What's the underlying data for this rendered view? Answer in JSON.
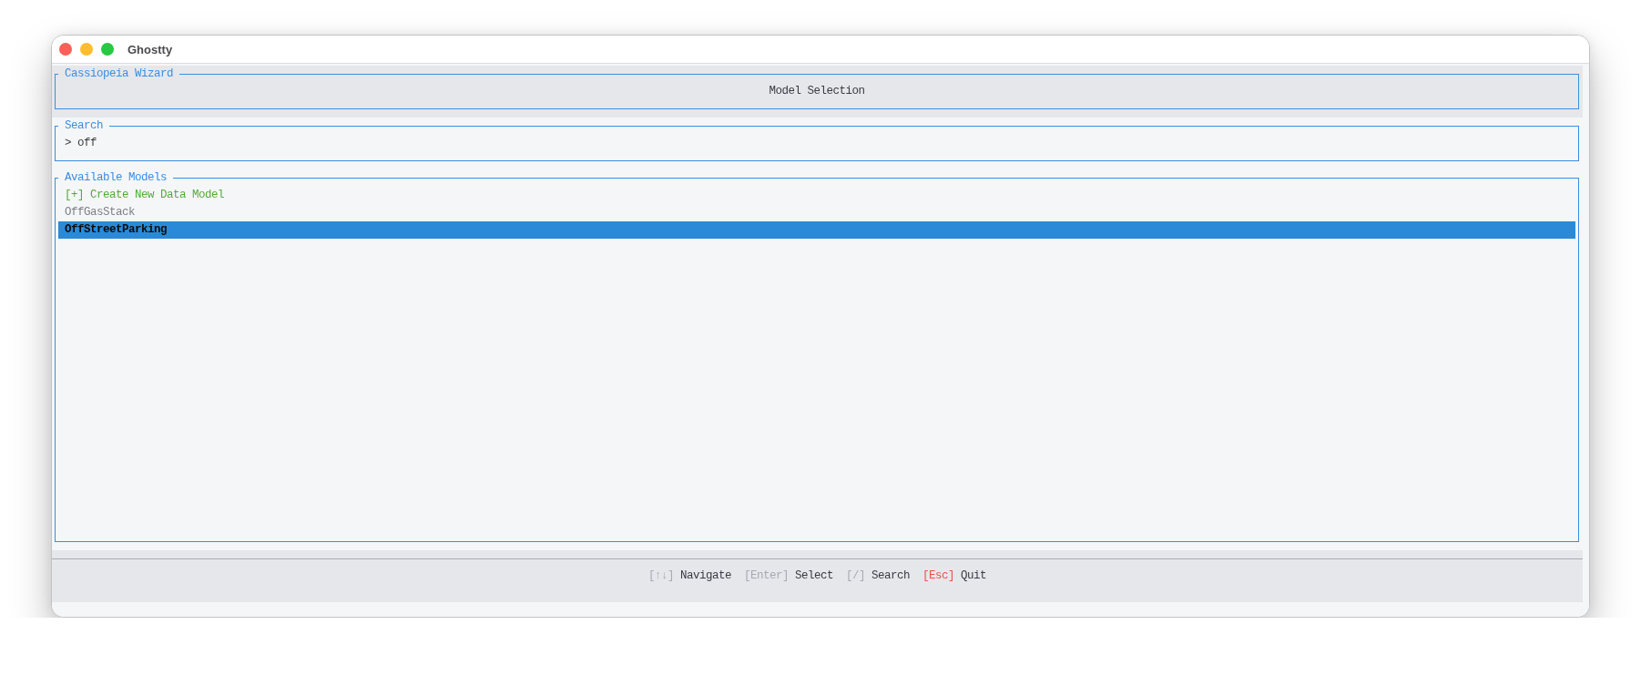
{
  "window": {
    "title": "Ghostty"
  },
  "header": {
    "title": "Cassiopeia Wizard",
    "heading": "Model Selection"
  },
  "search": {
    "title": "Search",
    "prompt": ">",
    "value": "off"
  },
  "models": {
    "title": "Available Models",
    "items": [
      {
        "kind": "create",
        "label": "[+] Create New Data Model",
        "selected": false
      },
      {
        "kind": "model",
        "label": "OffGasStack",
        "selected": false
      },
      {
        "kind": "model",
        "label": "OffStreetParking",
        "selected": true
      }
    ]
  },
  "footer": {
    "hints": [
      {
        "key": "[↑↓]",
        "label": "Navigate",
        "color": "#a8aab0"
      },
      {
        "key": "[Enter]",
        "label": "Select",
        "color": "#a8aab0"
      },
      {
        "key": "[/]",
        "label": "Search",
        "color": "#a8aab0"
      },
      {
        "key": "[Esc]",
        "label": "Quit",
        "color": "#e5534b"
      }
    ]
  }
}
